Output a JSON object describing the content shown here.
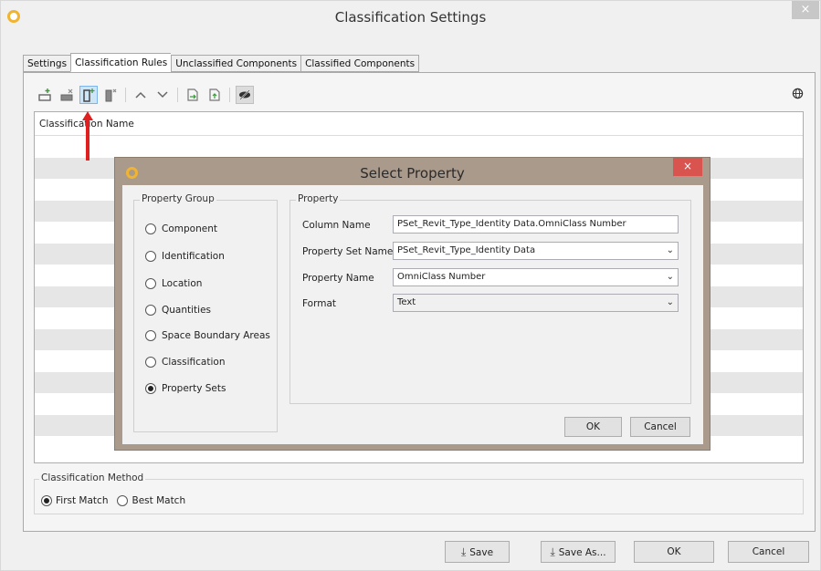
{
  "window": {
    "title": "Classification Settings",
    "close_glyph": "×"
  },
  "tabs": [
    {
      "label": "Settings",
      "active": false
    },
    {
      "label": "Classification Rules",
      "active": true
    },
    {
      "label": "Unclassified Components",
      "active": false
    },
    {
      "label": "Classified Components",
      "active": false
    }
  ],
  "toolbar": {
    "icons": [
      "add-rule-icon",
      "delete-rule-icon",
      "add-column-icon",
      "delete-column-icon",
      "move-up-icon",
      "move-down-icon",
      "import-icon",
      "export-icon",
      "visibility-icon"
    ],
    "right_icon": "globe-icon"
  },
  "grid": {
    "column_header": "Classification Name"
  },
  "method": {
    "legend": "Classification Method",
    "options": [
      {
        "label": "First Match",
        "checked": true
      },
      {
        "label": "Best Match",
        "checked": false
      }
    ]
  },
  "buttons": {
    "save": "Save",
    "save_as": "Save As...",
    "ok": "OK",
    "cancel": "Cancel"
  },
  "dialog": {
    "title": "Select Property",
    "close_glyph": "×",
    "property_group": {
      "legend": "Property Group",
      "options": [
        {
          "label": "Component",
          "checked": false
        },
        {
          "label": "Identification",
          "checked": false
        },
        {
          "label": "Location",
          "checked": false
        },
        {
          "label": "Quantities",
          "checked": false
        },
        {
          "label": "Space Boundary Areas",
          "checked": false
        },
        {
          "label": "Classification",
          "checked": false
        },
        {
          "label": "Property Sets",
          "checked": true
        }
      ]
    },
    "property": {
      "legend": "Property",
      "column_name_label": "Column Name",
      "column_name_value": "PSet_Revit_Type_Identity Data.OmniClass Number",
      "property_set_label": "Property Set Name",
      "property_set_value": "PSet_Revit_Type_Identity Data",
      "property_name_label": "Property Name",
      "property_name_value": "OmniClass Number",
      "format_label": "Format",
      "format_value": "Text"
    },
    "ok": "OK",
    "cancel": "Cancel"
  },
  "colors": {
    "accent_logo": "#f0b430",
    "dialog_frame": "#aa9a8c",
    "dialog_close": "#d9534f",
    "arrow": "#e02020",
    "active_tool": "#cde6f7"
  }
}
